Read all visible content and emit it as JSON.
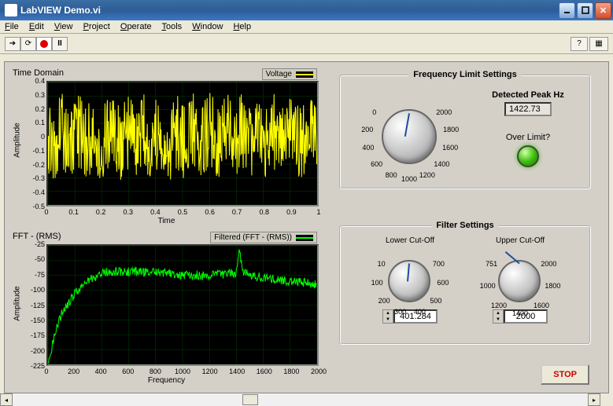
{
  "window": {
    "title": "LabVIEW Demo.vi"
  },
  "menus": [
    "File",
    "Edit",
    "View",
    "Project",
    "Operate",
    "Tools",
    "Window",
    "Help"
  ],
  "chart1": {
    "title": "Time Domain",
    "legend": "Voltage",
    "xlabel": "Time",
    "ylabel": "Amplitude",
    "yticks": [
      "0.4",
      "0.3",
      "0.2",
      "0.1",
      "0",
      "-0.1",
      "-0.2",
      "-0.3",
      "-0.4",
      "-0.5"
    ],
    "xticks": [
      "0",
      "0.1",
      "0.2",
      "0.3",
      "0.4",
      "0.5",
      "0.6",
      "0.7",
      "0.8",
      "0.9",
      "1"
    ]
  },
  "chart2": {
    "title": "FFT - (RMS)",
    "legend": "Filtered (FFT - (RMS))",
    "xlabel": "Frequency",
    "ylabel": "Amplitude",
    "yticks": [
      "-25",
      "-50",
      "-75",
      "-100",
      "-125",
      "-150",
      "-175",
      "-200",
      "-225"
    ],
    "xticks": [
      "0",
      "200",
      "400",
      "600",
      "800",
      "1000",
      "1200",
      "1400",
      "1600",
      "1800",
      "2000"
    ]
  },
  "freq_panel": {
    "title": "Frequency Limit Settings",
    "detected_label": "Detected Peak Hz",
    "detected_value": "1422.73",
    "over_label": "Over Limit?",
    "dial_ticks": [
      "0",
      "200",
      "400",
      "600",
      "800",
      "1000",
      "1200",
      "1400",
      "1600",
      "1800",
      "2000"
    ]
  },
  "filter_panel": {
    "title": "Filter Settings",
    "lower_label": "Lower Cut-Off",
    "upper_label": "Upper Cut-Off",
    "lower_value": "401.284",
    "upper_value": "2000",
    "lower_ticks": [
      "10",
      "100",
      "200",
      "300",
      "400",
      "500",
      "600",
      "700"
    ],
    "upper_ticks": [
      "751",
      "1000",
      "1200",
      "1400",
      "1600",
      "1800",
      "2000"
    ]
  },
  "stop_label": "STOP",
  "chart_data": [
    {
      "type": "line",
      "title": "Time Domain",
      "xlabel": "Time",
      "ylabel": "Amplitude",
      "xlim": [
        0,
        1
      ],
      "ylim": [
        -0.5,
        0.4
      ],
      "series": [
        {
          "name": "Voltage",
          "color": "#ffff00",
          "note": "noisy signal oscillating roughly between -0.4 and 0.4"
        }
      ]
    },
    {
      "type": "line",
      "title": "FFT - (RMS)",
      "xlabel": "Frequency",
      "ylabel": "Amplitude",
      "xlim": [
        0,
        2000
      ],
      "ylim": [
        -225,
        -25
      ],
      "series": [
        {
          "name": "Filtered (FFT - (RMS))",
          "color": "#00ff00",
          "envelope_x": [
            0,
            50,
            100,
            200,
            300,
            400,
            600,
            800,
            1000,
            1200,
            1400,
            1420,
            1450,
            1600,
            1800,
            2000
          ],
          "envelope_y": [
            -225,
            -175,
            -140,
            -105,
            -85,
            -70,
            -68,
            -70,
            -75,
            -75,
            -70,
            -28,
            -70,
            -80,
            -85,
            -90
          ]
        }
      ]
    }
  ]
}
